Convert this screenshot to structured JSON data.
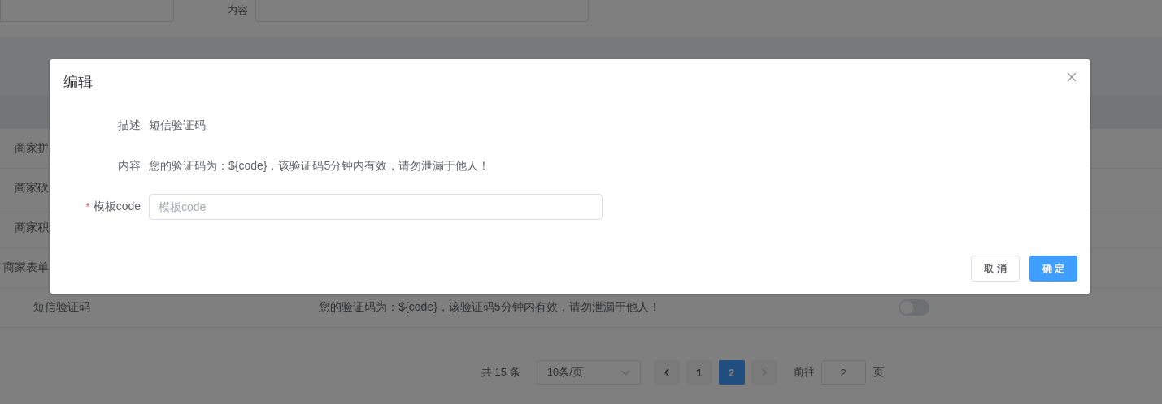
{
  "filter": {
    "content_label": "内容"
  },
  "table": {
    "rows": [
      {
        "name": "商家拼"
      },
      {
        "name": "商家砍"
      },
      {
        "name": "商家积"
      },
      {
        "name": "商家表单"
      },
      {
        "name": "短信验证码",
        "content": "您的验证码为：${code}，该验证码5分钟内有效，请勿泄漏于他人！",
        "enabled": false
      }
    ]
  },
  "pagination": {
    "total": "共 15 条",
    "page_size": "10条/页",
    "pages": [
      {
        "label": "1",
        "selected": false
      },
      {
        "label": "2",
        "selected": true
      }
    ],
    "goto_label": "前往",
    "goto_value": "2",
    "page_unit": "页"
  },
  "dialog": {
    "title": "编辑",
    "fields": [
      {
        "kind": "text",
        "label": "描述",
        "value": "短信验证码"
      },
      {
        "kind": "text",
        "label": "内容",
        "value": "您的验证码为：${code}，该验证码5分钟内有效，请勿泄漏于他人！"
      },
      {
        "kind": "input",
        "required_mark": "*",
        "label": "模板code",
        "placeholder": "模板code"
      }
    ],
    "buttons": [
      {
        "label": "取 消",
        "kind": "default"
      },
      {
        "label": "确 定",
        "kind": "primary"
      }
    ]
  }
}
